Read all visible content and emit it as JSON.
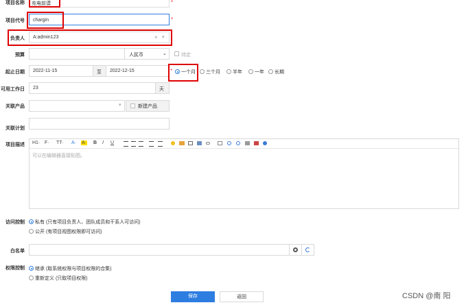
{
  "form": {
    "project_name": {
      "label": "项目名称",
      "value": "充电前谟"
    },
    "project_code": {
      "label": "项目代号",
      "value": "chargin"
    },
    "owner": {
      "label": "负责人",
      "value": "A:admin123",
      "clear": "×",
      "arrow": "▾"
    },
    "budget": {
      "label": "预算",
      "currency": "人民币",
      "note": "待定"
    },
    "dates": {
      "label": "起止日期",
      "start": "2022-11-15",
      "sep": "至",
      "end": "2022-12-15",
      "options": [
        "一个月",
        "三个月",
        "半年",
        "一年",
        "长期"
      ],
      "selected": 0
    },
    "workdays": {
      "label": "可用工作日",
      "value": "23",
      "unit": "天"
    },
    "product": {
      "label": "关联产品",
      "add_label": "新建产品"
    },
    "plan": {
      "label": "关联计划"
    },
    "description": {
      "label": "项目描述",
      "placeholder": "可以在编辑器直接贴图。",
      "toolbar": [
        "H1·",
        "F·",
        "TT·",
        "A·",
        "A·",
        "B",
        "I",
        "U"
      ]
    },
    "access": {
      "label": "访问控制",
      "options": [
        "私有 (只有项目负责人、团队成员和干系人可访问)",
        "公开 (有项目视图权限即可访问)"
      ],
      "selected": 0
    },
    "whitelist": {
      "label": "白名单"
    },
    "permission": {
      "label": "权限控制",
      "options": [
        "继承 (取系统权限与项目权限的合集)",
        "重新定义 (只取项目权限)"
      ],
      "selected": 0
    }
  },
  "buttons": {
    "save": "保存",
    "back": "返回"
  },
  "watermark": "CSDN @南 阳",
  "colors": {
    "accent": "#2e7de1",
    "highlight": "#d00000"
  }
}
